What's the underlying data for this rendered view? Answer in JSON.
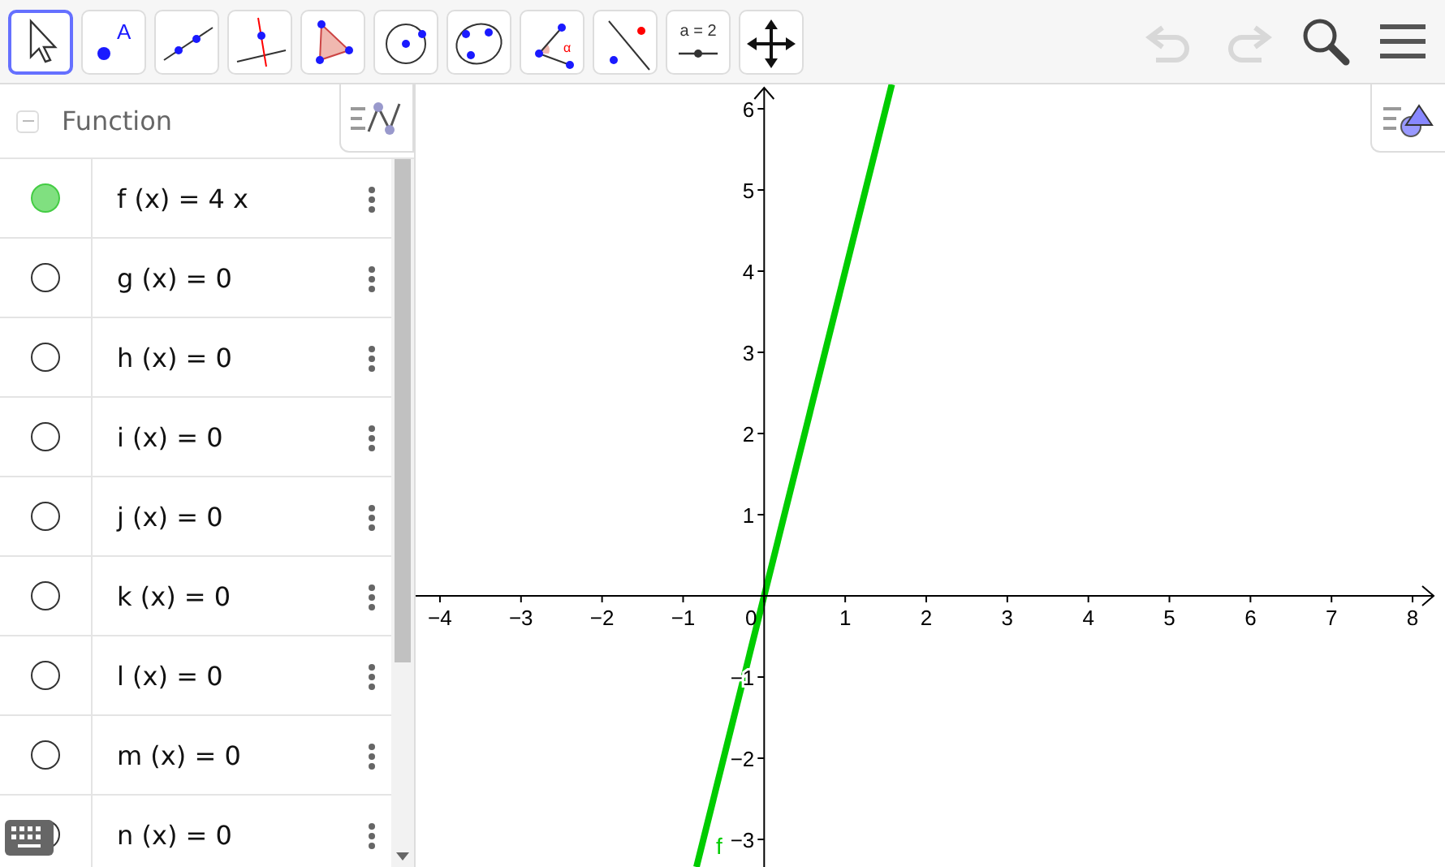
{
  "toolbar": {
    "tools": [
      {
        "kind": "move",
        "selected": true
      },
      {
        "kind": "point",
        "selected": false,
        "label": "A"
      },
      {
        "kind": "line",
        "selected": false
      },
      {
        "kind": "perpendicular",
        "selected": false
      },
      {
        "kind": "polygon",
        "selected": false
      },
      {
        "kind": "circle",
        "selected": false
      },
      {
        "kind": "conic",
        "selected": false
      },
      {
        "kind": "angle",
        "selected": false,
        "label": "α"
      },
      {
        "kind": "reflect",
        "selected": false
      },
      {
        "kind": "slider",
        "selected": false,
        "label": "a = 2"
      },
      {
        "kind": "pan",
        "selected": false
      }
    ],
    "history": [
      {
        "kind": "undo",
        "disabled": true
      },
      {
        "kind": "redo",
        "disabled": true
      }
    ]
  },
  "algebra": {
    "header": "Function",
    "rows": [
      {
        "label": "f (x) = 4 x",
        "visible": true
      },
      {
        "label": "g (x) = 0",
        "visible": false
      },
      {
        "label": "h (x) = 0",
        "visible": false
      },
      {
        "label": "i (x) = 0",
        "visible": false
      },
      {
        "label": "j (x) = 0",
        "visible": false
      },
      {
        "label": "k (x) = 0",
        "visible": false
      },
      {
        "label": "l (x) = 0",
        "visible": false
      },
      {
        "label": "m (x) = 0",
        "visible": false
      },
      {
        "label": "n (x) = 0",
        "visible": false
      }
    ]
  },
  "graphics": {
    "chart_data": {
      "type": "line",
      "x": [
        -0.835,
        1.575
      ],
      "series": [
        {
          "name": "f",
          "color": "#00cc00",
          "values": [
            -3.34,
            6.3
          ]
        }
      ],
      "xlim": [
        -4.3,
        8.3
      ],
      "ylim": [
        -3.34,
        6.3
      ],
      "xticks": [
        -4,
        -3,
        -2,
        -1,
        0,
        1,
        2,
        3,
        4,
        5,
        6,
        7,
        8
      ],
      "yticks": [
        -3,
        -2,
        -1,
        1,
        2,
        3,
        4,
        5,
        6
      ]
    }
  }
}
